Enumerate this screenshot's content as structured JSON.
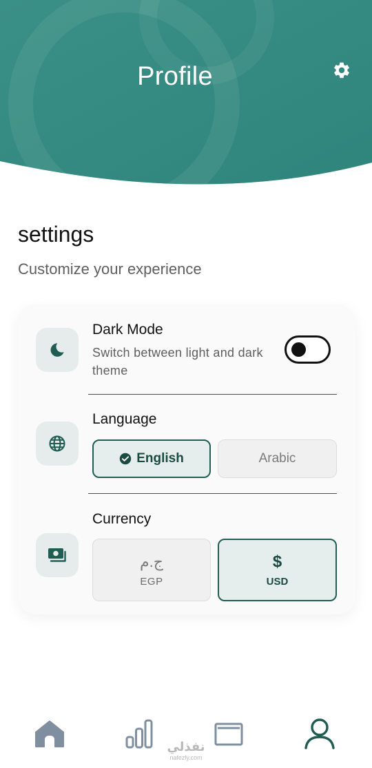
{
  "header": {
    "title": "Profile",
    "bg_color": "#3a9088",
    "settings_icon": "gear-icon"
  },
  "settings": {
    "title": "settings",
    "subtitle": "Customize your experience"
  },
  "dark_mode": {
    "icon": "moon-icon",
    "label": "Dark Mode",
    "description": "Switch between light and dark theme",
    "enabled": false
  },
  "language": {
    "icon": "globe-icon",
    "label": "Language",
    "options": [
      {
        "label": "English",
        "selected": true
      },
      {
        "label": "Arabic",
        "selected": false
      }
    ]
  },
  "currency": {
    "icon": "money-icon",
    "label": "Currency",
    "options": [
      {
        "symbol": "ج.م",
        "code": "EGP",
        "selected": false
      },
      {
        "symbol": "$",
        "code": "USD",
        "selected": true
      }
    ]
  },
  "bottom_nav": {
    "items": [
      {
        "icon": "home-icon",
        "active": false
      },
      {
        "icon": "bar-chart-icon",
        "active": false
      },
      {
        "icon": "wallet-icon",
        "active": false
      },
      {
        "icon": "user-icon",
        "active": true
      }
    ]
  },
  "watermark": {
    "arabic": "نفذلي",
    "latin": "nafezly.com"
  },
  "colors": {
    "accent": "#1f5d52",
    "accent_dark": "#1a4a42",
    "icon_gray": "#7f8fa0"
  }
}
